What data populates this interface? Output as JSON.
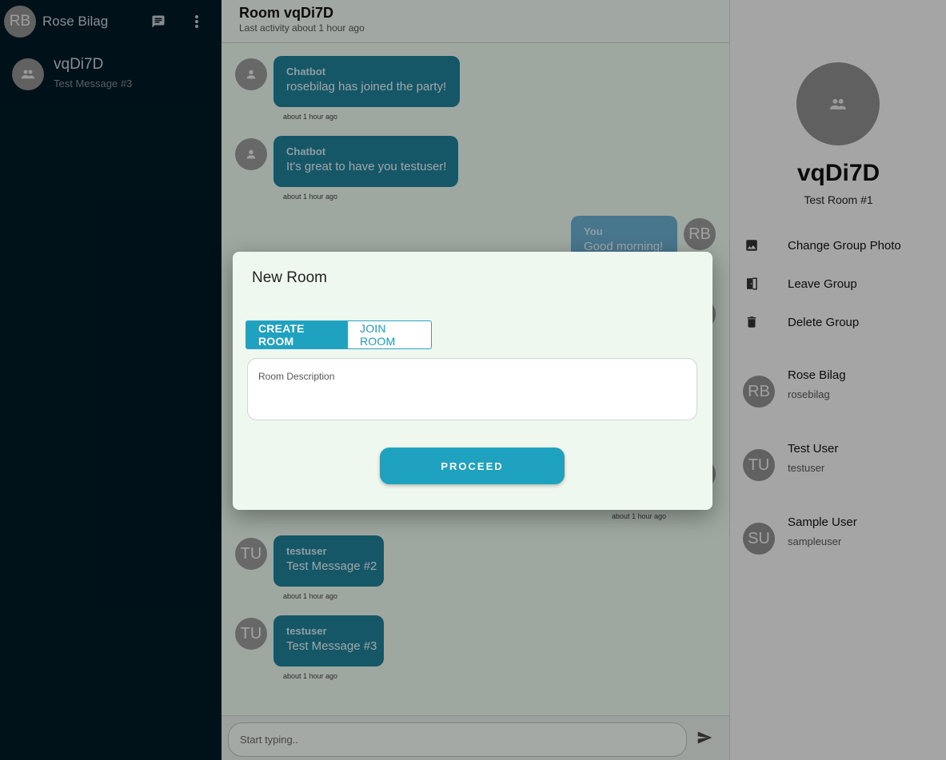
{
  "sidebar": {
    "me": {
      "initials": "RB",
      "name": "Rose Bilag"
    },
    "rooms": [
      {
        "name": "vqDi7D",
        "last_message": "Test Message #3"
      }
    ]
  },
  "chat": {
    "title": "Room vqDi7D",
    "subtitle": "Last activity about 1 hour ago",
    "messages": [
      {
        "sender": "Chatbot",
        "text": "rosebilag has joined the party!",
        "time": "about 1 hour ago",
        "avatar": ""
      },
      {
        "sender": "Chatbot",
        "text": "It's great to have you testuser!",
        "time": "about 1 hour ago",
        "avatar": ""
      },
      {
        "sender": "You",
        "text": "Good morning!",
        "time": "",
        "avatar": "RB"
      },
      {
        "sender": "",
        "text": "",
        "time": "about 1 hour ago",
        "avatar": ""
      },
      {
        "sender": "testuser",
        "text": "Test Message #2",
        "time": "about 1 hour ago",
        "avatar": "TU"
      },
      {
        "sender": "testuser",
        "text": "Test Message #3",
        "time": "about 1 hour ago",
        "avatar": "TU"
      }
    ],
    "composer_placeholder": "Start typing.."
  },
  "details": {
    "room_name": "vqDi7D",
    "room_description": "Test Room #1",
    "actions": [
      {
        "label": "Change Group Photo",
        "icon": "image-icon"
      },
      {
        "label": "Leave Group",
        "icon": "door-exit-icon"
      },
      {
        "label": "Delete Group",
        "icon": "trash-icon"
      }
    ],
    "members": [
      {
        "initials": "RB",
        "name": "Rose Bilag",
        "username": "rosebilag"
      },
      {
        "initials": "TU",
        "name": "Test User",
        "username": "testuser"
      },
      {
        "initials": "SU",
        "name": "Sample User",
        "username": "sampleuser"
      }
    ]
  },
  "modal": {
    "title": "New Room",
    "tabs": [
      {
        "label": "CREATE ROOM",
        "active": true
      },
      {
        "label": "JOIN ROOM",
        "active": false
      }
    ],
    "description_label": "Room Description",
    "description_value": "",
    "proceed_label": "PROCEED"
  },
  "colors": {
    "sidebar_bg": "#001a25",
    "bubble": "#1f7f99",
    "accent": "#1fa1c0",
    "modal_bg": "#eff8ee"
  }
}
